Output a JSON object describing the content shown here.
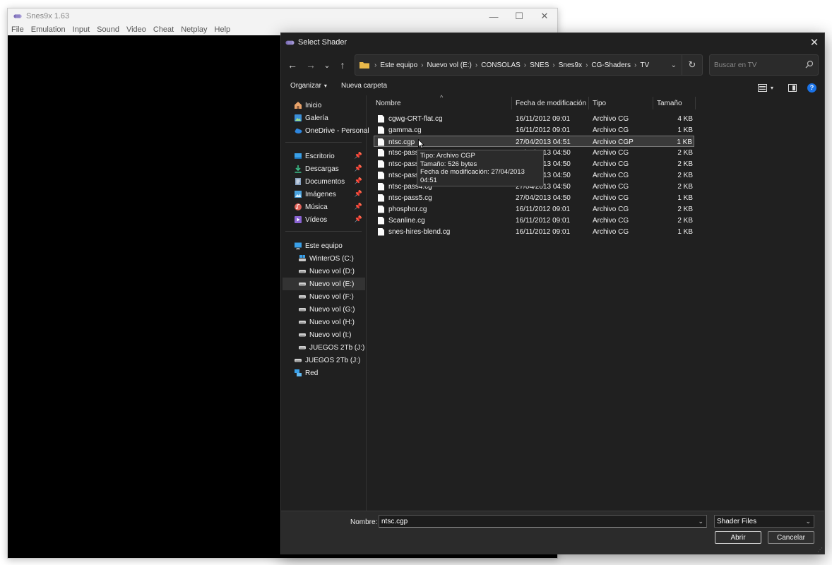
{
  "snes_window": {
    "title": "Snes9x 1.63",
    "controls": {
      "minimize": "—",
      "maximize": "☐",
      "close": "✕"
    },
    "menu": [
      "File",
      "Emulation",
      "Input",
      "Sound",
      "Video",
      "Cheat",
      "Netplay",
      "Help"
    ]
  },
  "dialog": {
    "title": "Select Shader",
    "close": "✕",
    "nav": {
      "back": "←",
      "forward": "→",
      "recent": "⌄",
      "up": "↑"
    },
    "breadcrumb": [
      "Este equipo",
      "Nuevo vol (E:)",
      "CONSOLAS",
      "SNES",
      "Snes9x",
      "CG-Shaders",
      "TV"
    ],
    "breadcrumb_sep": "›",
    "address_chevron": "⌄",
    "refresh": "↻",
    "search_placeholder": "Buscar en TV",
    "toolbar": {
      "organize": "Organizar",
      "new_folder": "Nueva carpeta",
      "view_chevron": "▾",
      "help": "?"
    },
    "columns": {
      "name": "Nombre",
      "date": "Fecha de modificación",
      "type": "Tipo",
      "size": "Tamaño"
    },
    "sidebar": {
      "quick": [
        {
          "label": "Inicio",
          "icon": "home-icon"
        },
        {
          "label": "Galería",
          "icon": "gallery-icon"
        },
        {
          "label": "OneDrive - Personal",
          "icon": "cloud-icon"
        }
      ],
      "pinned": [
        {
          "label": "Escritorio",
          "icon": "desktop-icon"
        },
        {
          "label": "Descargas",
          "icon": "download-icon"
        },
        {
          "label": "Documentos",
          "icon": "document-icon"
        },
        {
          "label": "Imágenes",
          "icon": "image-icon"
        },
        {
          "label": "Música",
          "icon": "music-icon"
        },
        {
          "label": "Vídeos",
          "icon": "video-icon"
        }
      ],
      "pin_glyph": "📌",
      "this_pc": "Este equipo",
      "drives": [
        "WinterOS (C:)",
        "Nuevo vol (D:)",
        "Nuevo vol (E:)",
        "Nuevo vol (F:)",
        "Nuevo vol (G:)",
        "Nuevo vol (H:)",
        "Nuevo vol (I:)",
        "JUEGOS 2Tb (J:)"
      ],
      "extra_drive": "JUEGOS 2Tb (J:)",
      "network": "Red"
    },
    "files": [
      {
        "name": "cgwg-CRT-flat.cg",
        "date": "16/11/2012 09:01",
        "type": "Archivo CG",
        "size": "4 KB"
      },
      {
        "name": "gamma.cg",
        "date": "16/11/2012 09:01",
        "type": "Archivo CG",
        "size": "1 KB"
      },
      {
        "name": "ntsc.cgp",
        "date": "27/04/2013 04:51",
        "type": "Archivo CGP",
        "size": "1 KB"
      },
      {
        "name": "ntsc-pass1.cg",
        "date": "27/04/2013 04:50",
        "type": "Archivo CG",
        "size": "2 KB"
      },
      {
        "name": "ntsc-pass2.cg",
        "date": "27/04/2013 04:50",
        "type": "Archivo CG",
        "size": "2 KB"
      },
      {
        "name": "ntsc-pass3.cg",
        "date": "27/04/2013 04:50",
        "type": "Archivo CG",
        "size": "2 KB"
      },
      {
        "name": "ntsc-pass4.cg",
        "date": "27/04/2013 04:50",
        "type": "Archivo CG",
        "size": "2 KB"
      },
      {
        "name": "ntsc-pass5.cg",
        "date": "27/04/2013 04:50",
        "type": "Archivo CG",
        "size": "1 KB"
      },
      {
        "name": "phosphor.cg",
        "date": "16/11/2012 09:01",
        "type": "Archivo CG",
        "size": "2 KB"
      },
      {
        "name": "Scanline.cg",
        "date": "16/11/2012 09:01",
        "type": "Archivo CG",
        "size": "2 KB"
      },
      {
        "name": "snes-hires-blend.cg",
        "date": "16/11/2012 09:01",
        "type": "Archivo CG",
        "size": "1 KB"
      }
    ],
    "tooltip": [
      "Tipo: Archivo CGP",
      "Tamaño: 526 bytes",
      "Fecha de modificación: 27/04/2013 04:51"
    ],
    "footer": {
      "filename_label": "Nombre:",
      "filename_value": "ntsc.cgp",
      "filetype_value": "Shader Files",
      "open": "Abrir",
      "cancel": "Cancelar",
      "chevron": "⌄"
    }
  },
  "colors": {
    "dialog_bg": "#202020",
    "footer_bg": "#2b2b2b",
    "selection": "#3a3a3a",
    "folder": "#e8b84a",
    "accent": "#1a73e8"
  }
}
